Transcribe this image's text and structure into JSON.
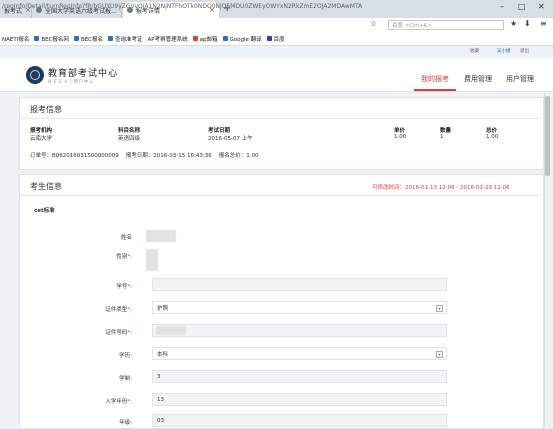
{
  "browser": {
    "tabs": [
      {
        "label": "报考式",
        "active": false
      },
      {
        "label": "全国大学英语六级考试报...",
        "active": false
      },
      {
        "label": "报考详情",
        "active": true
      }
    ],
    "new_tab_icon": "plus-icon",
    "url": "/regInfo/Detail/turnRegInfo?fR/bGUYU9yZGVyQjA1N2NjNTFhOTk0NDQ0NjQ5MDU0ZWEyOWYxN2RkZmE2OjA2MDAwMTAwM",
    "search_placeholder": "百度 <Ctrl+K>",
    "bookmarks": [
      "NAETI报名",
      "BEC报名网",
      "BEC报名",
      "查询准考证",
      "AP考察管理系统",
      "ap邮箱",
      "Google 翻译",
      "百度"
    ]
  },
  "toplinks": {
    "bookmark": "收藏",
    "user": "吴小捷",
    "logout": "退出"
  },
  "site": {
    "brand": "教育部考试中心",
    "brand_sub": "N E E A  |  用户中心",
    "nav": [
      {
        "label": "我的报考",
        "active": true
      },
      {
        "label": "费用管理",
        "active": false
      },
      {
        "label": "用户管理",
        "active": false
      }
    ]
  },
  "reg_info": {
    "title": "报考信息",
    "headers": [
      "报考机构",
      "科目名称",
      "考试日期",
      "单价",
      "数量",
      "总价"
    ],
    "row": [
      "云南大学",
      "英语四级",
      "2016-05-07 上午",
      "1.00",
      "1",
      "1.00"
    ],
    "order_no_label": "订单号：",
    "order_no": "B062016031500000009",
    "reg_date_label": "报考日期：",
    "reg_date": "2016-03-15 16:43:36",
    "total_label": "报名总价：",
    "total": "1.00"
  },
  "candidate": {
    "title": "考生信息",
    "edit_time": "可修改时间：2016-01-13 12:06 - 2016-01-29 12:06",
    "section": "cet标准",
    "fields": [
      {
        "label": "姓名",
        "required": false,
        "value": "",
        "type": "blurred"
      },
      {
        "label": "性别",
        "required": true,
        "value": "",
        "type": "blurred"
      },
      {
        "label": "学号",
        "required": true,
        "value": "",
        "type": "input"
      },
      {
        "label": "证件类型",
        "required": true,
        "value": "护照",
        "type": "select"
      },
      {
        "label": "证件号码",
        "required": true,
        "value": "",
        "type": "blurred-input"
      },
      {
        "label": "学历",
        "required": false,
        "value": "本科",
        "type": "select"
      },
      {
        "label": "学制",
        "required": false,
        "value": "3",
        "type": "input"
      },
      {
        "label": "入学年份",
        "required": true,
        "value": "13",
        "type": "input"
      },
      {
        "label": "年级",
        "required": false,
        "value": "03",
        "type": "input"
      }
    ]
  }
}
